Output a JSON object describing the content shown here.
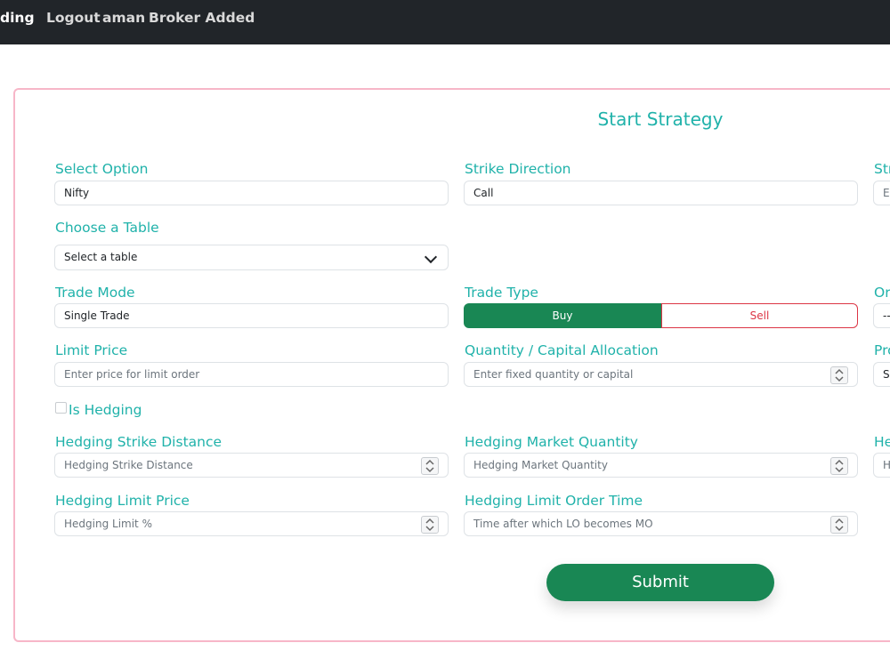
{
  "nav": {
    "brand": "ding",
    "logout": "Logout",
    "user": "aman",
    "broker_status": "Broker Added"
  },
  "form": {
    "title": "Start Strategy",
    "select_option": {
      "label": "Select Option",
      "value": "Nifty"
    },
    "strike_direction": {
      "label": "Strike Direction",
      "value": "Call"
    },
    "col3_row1": {
      "label": "Str",
      "placeholder": "Er"
    },
    "choose_table": {
      "label": "Choose a Table",
      "value": "Select a table"
    },
    "trade_mode": {
      "label": "Trade Mode",
      "value": "Single Trade"
    },
    "trade_type": {
      "label": "Trade Type",
      "buy": "Buy",
      "sell": "Sell",
      "selected": "Buy"
    },
    "col3_row3": {
      "label": "Or",
      "value": "--"
    },
    "limit_price": {
      "label": "Limit Price",
      "placeholder": "Enter price for limit order"
    },
    "quantity": {
      "label": "Quantity / Capital Allocation",
      "placeholder": "Enter fixed quantity or capital"
    },
    "col3_row4": {
      "label": "Pro",
      "value": "Se"
    },
    "is_hedging": {
      "label": "Is Hedging",
      "checked": false
    },
    "hedging_strike_distance": {
      "label": "Hedging Strike Distance",
      "placeholder": "Hedging Strike Distance"
    },
    "hedging_market_quantity": {
      "label": "Hedging Market Quantity",
      "placeholder": "Hedging Market Quantity"
    },
    "col3_row5": {
      "label": "He",
      "placeholder": "H"
    },
    "hedging_limit_price": {
      "label": "Hedging Limit Price",
      "placeholder": "Hedging Limit %"
    },
    "hedging_limit_order_time": {
      "label": "Hedging Limit Order Time",
      "placeholder": "Time after which LO becomes MO"
    },
    "submit": "Submit"
  },
  "colors": {
    "accent": "#20b2aa",
    "buy": "#198754",
    "sell": "#dc3545",
    "card_border": "#f7b6c8",
    "topbar": "#212529"
  },
  "icons": [
    "chevron-down-icon",
    "spinner-arrows-icon"
  ]
}
